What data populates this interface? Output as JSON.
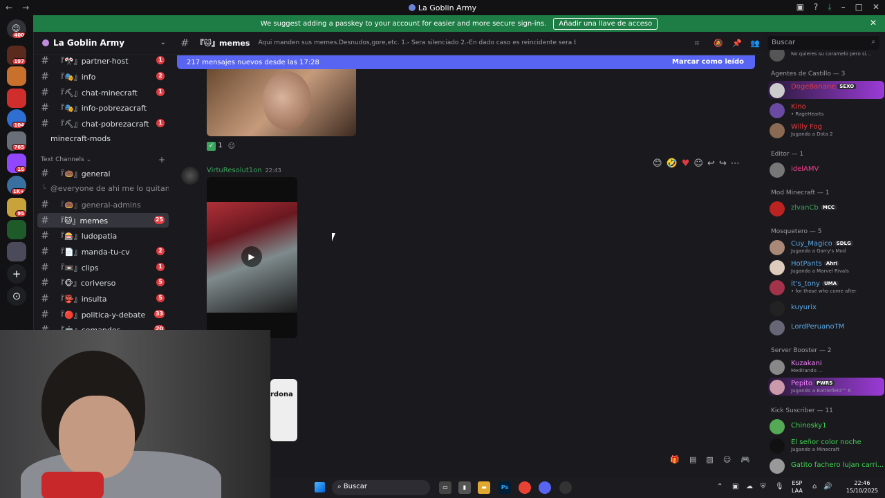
{
  "window": {
    "title": "La Goblin Army"
  },
  "banner": {
    "text": "We suggest adding a passkey to your account for easier and more secure sign-ins.",
    "button": "Añadir una llave de acceso"
  },
  "servers": [
    {
      "badge": "400"
    },
    {
      "badge": "197"
    },
    {
      "badge": ""
    },
    {
      "badge": ""
    },
    {
      "badge": "104"
    },
    {
      "badge": "765"
    },
    {
      "badge": "16"
    },
    {
      "badge": "1K+"
    },
    {
      "badge": "95"
    },
    {
      "badge": ""
    },
    {
      "badge": ""
    }
  ],
  "guild": {
    "name": "La Goblin Army"
  },
  "channels": {
    "top": [
      {
        "name": "『🎌』partner-host",
        "count": "1"
      },
      {
        "name": "『🎭』info",
        "count": "2"
      },
      {
        "name": "『⛏』chat-minecraft",
        "count": "1"
      },
      {
        "name": "『🎭』info-pobrezacraft",
        "count": ""
      },
      {
        "name": "『⛏』chat-pobrezacraft",
        "count": "1"
      }
    ],
    "mods": "minecraft-mods",
    "category": "Text Channels",
    "text": [
      {
        "name": "『🍩』general",
        "count": ""
      },
      {
        "name": "@everyone de ahi me lo quitan ch...",
        "count": ""
      },
      {
        "name": "『🍩』general-admins",
        "count": ""
      },
      {
        "name": "『🐱』memes",
        "count": "25"
      },
      {
        "name": "『🎰』ludopatia",
        "count": ""
      },
      {
        "name": "『📄』manda-tu-cv",
        "count": "2"
      },
      {
        "name": "『📼』clips",
        "count": "1"
      },
      {
        "name": "『🐵』coriverso",
        "count": "5"
      },
      {
        "name": "『👺』insulta",
        "count": "5"
      },
      {
        "name": "『🔴』politica-y-debate",
        "count": "33"
      },
      {
        "name": "『🤖』comandos",
        "count": "20"
      }
    ]
  },
  "topbar": {
    "channel": "『🐱』memes",
    "topic": "Aqui manden sus memes.Desnudos,gore,etc. 1.- Sera silenciado 2.-En dado caso es reincidente sera baneado",
    "search_placeholder": "Buscar"
  },
  "newbar": {
    "text": "217 mensajes nuevos desde las 17:28",
    "action": "Marcar como leído"
  },
  "message": {
    "reaction_count": "1",
    "author": "VirtuResolut1on",
    "time": "22:43",
    "attach_text": "rdona"
  },
  "members": {
    "groups": [
      {
        "title": "Agentes de Castillo — 3"
      },
      {
        "title": "Editor — 1"
      },
      {
        "title": "Mod Minecraft — 1"
      },
      {
        "title": "Mosquetero — 5"
      },
      {
        "title": "Server Booster — 2"
      },
      {
        "title": "Kick Suscriber — 11"
      }
    ],
    "prev_status": "No quieres su caramelo pero si...",
    "list": [
      {
        "name": "DogeBanane",
        "tag": "SEXO",
        "status": "",
        "color": "#e8383b"
      },
      {
        "name": "Kino",
        "tag": "",
        "status": "• RageHearts",
        "color": "#e8383b"
      },
      {
        "name": "Willy Fog",
        "tag": "",
        "status": "Jugando a Dota 2",
        "color": "#e8383b"
      },
      {
        "name": "idelAMV",
        "tag": "",
        "status": "",
        "color": "#f23f8c"
      },
      {
        "name": "zlvanCb",
        "tag": "MCC",
        "status": "",
        "color": "#3ba55d"
      },
      {
        "name": "Cuy_Magico",
        "tag": "SDLG",
        "status": "Jugando a Garry's Mod",
        "color": "#5ba8e6"
      },
      {
        "name": "HotPants",
        "tag": "Ahri",
        "status": "Jugando a Marvel Rivals",
        "color": "#5ba8e6"
      },
      {
        "name": "it's_tony",
        "tag": "UMA",
        "status": "• for those who come after",
        "color": "#5ba8e6"
      },
      {
        "name": "kuyurix",
        "tag": "",
        "status": "",
        "color": "#5ba8e6"
      },
      {
        "name": "LordPeruanoTM",
        "tag": "",
        "status": "",
        "color": "#5ba8e6"
      },
      {
        "name": "Kuzakani",
        "tag": "",
        "status": "Meditando ...",
        "color": "#f47fff"
      },
      {
        "name": "Pepito",
        "tag": "PWRS",
        "status": "Jugando a Battlefield™ 6",
        "color": "#f47fff"
      },
      {
        "name": "Chinosky1",
        "tag": "",
        "status": "",
        "color": "#3ed44f"
      },
      {
        "name": "El señor color noche",
        "tag": "",
        "status": "Jugando a Minecraft",
        "color": "#3ed44f"
      },
      {
        "name": "Gatito fachero lujan carri...",
        "tag": "",
        "status": "",
        "color": "#3ed44f"
      }
    ]
  },
  "taskbar": {
    "search": "Buscar",
    "lang1": "ESP",
    "lang2": "LAA",
    "time": "22:46",
    "date": "15/10/2025"
  }
}
